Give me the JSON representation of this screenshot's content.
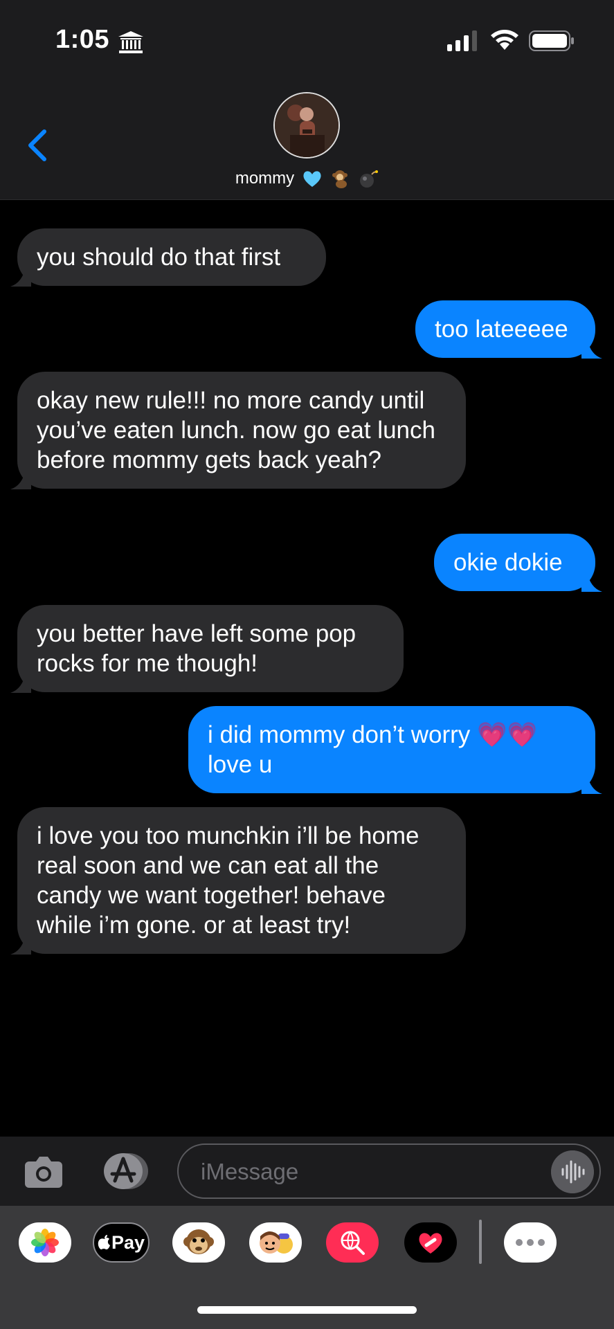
{
  "status_bar": {
    "time": "1:05"
  },
  "header": {
    "contact_name": "mommy"
  },
  "messages": [
    {
      "dir": "in",
      "text": "you should do that first"
    },
    {
      "dir": "out",
      "text": "too lateeeee"
    },
    {
      "dir": "in",
      "text": "okay new rule!!! no more candy until you’ve eaten lunch. now go eat lunch before mommy gets back yeah?"
    },
    {
      "dir": "out",
      "text": "okie dokie"
    },
    {
      "dir": "in",
      "text": "you better have left some pop rocks for me though!"
    },
    {
      "dir": "out",
      "text": "i did mommy don’t worry 💗💗 love u"
    },
    {
      "dir": "in",
      "text": "i love you too munchkin i’ll be home real soon and we can eat all the candy we want together! behave while i’m gone. or at least try!"
    }
  ],
  "input": {
    "placeholder": "iMessage"
  },
  "app_strip": {
    "apple_pay_label": "Pay"
  },
  "colors": {
    "incoming": "#2c2c2e",
    "outgoing": "#0a84ff",
    "accent": "#0a84ff"
  }
}
